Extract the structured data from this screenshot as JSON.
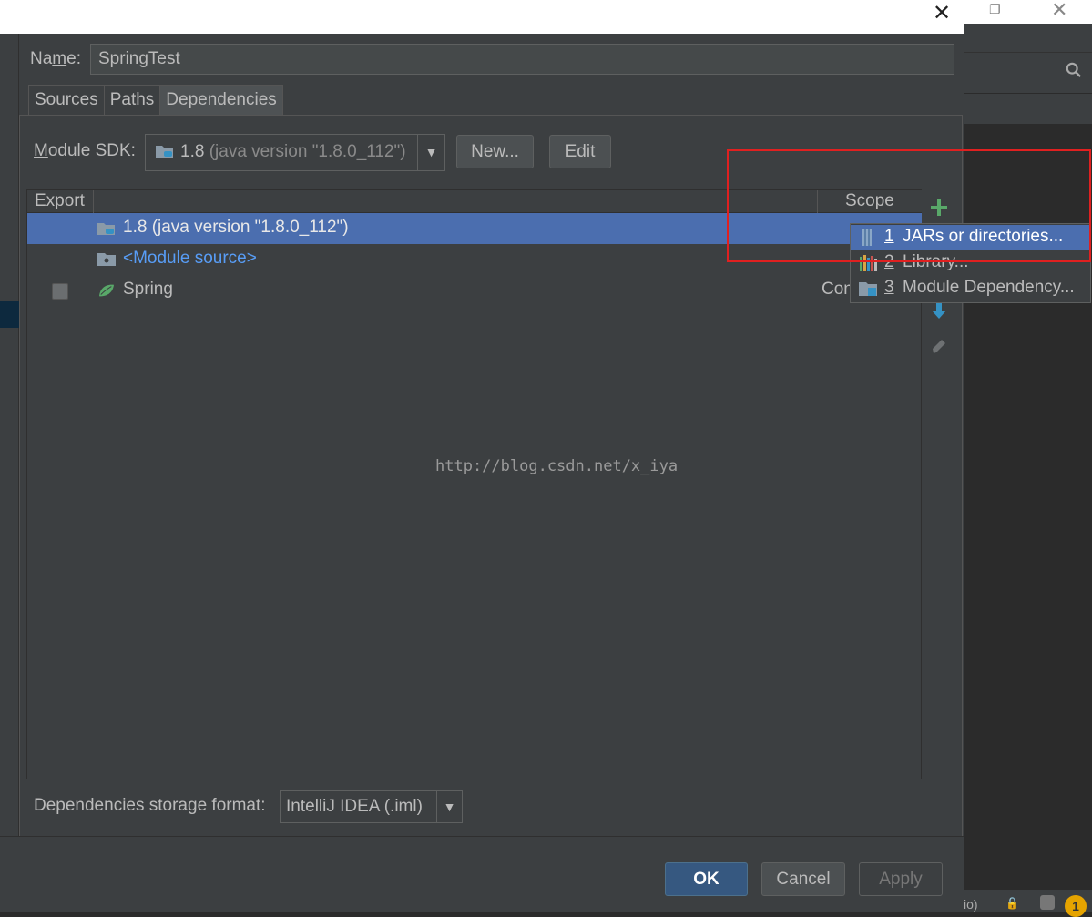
{
  "dialog": {
    "close_glyph": "✕",
    "name_label_pre": "Na",
    "name_label_u": "m",
    "name_label_post": "e:",
    "name_value": "SpringTest",
    "tabs": [
      {
        "label": "Sources"
      },
      {
        "label": "Paths"
      },
      {
        "label": "Dependencies"
      }
    ],
    "active_tab": "Dependencies",
    "sdk": {
      "label_u": "M",
      "label_rest": "odule SDK:",
      "value_main": "1.8",
      "value_dim": " (java version \"1.8.0_112\")",
      "new_label_u": "N",
      "new_label_rest": "ew...",
      "edit_label_u": "E",
      "edit_label_rest": "dit"
    },
    "table": {
      "header_export": "Export",
      "header_scope": "Scope",
      "rows": [
        {
          "name": "1.8 (java version \"1.8.0_112\")",
          "selected": true
        },
        {
          "name": "<Module source>"
        },
        {
          "name": "Spring",
          "scope": "Con",
          "exported": false
        }
      ]
    },
    "watermark": "http://blog.csdn.net/x_iya",
    "popup_menu": [
      {
        "num": "1",
        "label": "JARs or directories...",
        "icon": "jar-icon",
        "selected": true
      },
      {
        "num": "2",
        "label": "Library...",
        "icon": "library-icon"
      },
      {
        "num": "3",
        "label": "Module Dependency...",
        "icon": "module-icon"
      }
    ],
    "storage": {
      "label": "Dependencies storage format:",
      "value": "IntelliJ IDEA (.iml)"
    },
    "buttons": {
      "ok": "OK",
      "cancel": "Cancel",
      "apply": "Apply"
    }
  },
  "background_ide": {
    "status_fragment": "io)",
    "notification_count": "1"
  },
  "colors": {
    "dialog_bg": "#3c3f41",
    "selection": "#4b6eaf",
    "highlight_box": "#e02020",
    "link": "#589df6",
    "add_green": "#59a869",
    "arrow_blue": "#3592c4"
  }
}
